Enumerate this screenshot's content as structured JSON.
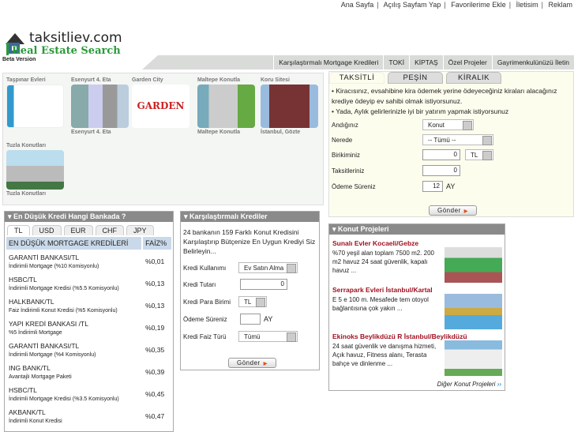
{
  "top_links": [
    "Ana Sayfa",
    "Açılış Sayfam Yap",
    "Favorilerime Ekle",
    "İletisim",
    "Reklam"
  ],
  "logo": {
    "name": "taksitliev.com",
    "tagline": "Real Estate Search"
  },
  "beta": "Beta Version",
  "nav": [
    "Karşılaştırmalı Mortgage Kredileri",
    "TOKİ",
    "KİPTAŞ",
    "Özel Projeler",
    "Gayrimenkulünüzü İletin"
  ],
  "projects": [
    {
      "top": "Taşpınar Evleri",
      "bottom": ""
    },
    {
      "top": "Esenyurt 4. Eta",
      "bottom": "Esenyurt 4. Eta"
    },
    {
      "top": "Garden City",
      "bottom": ""
    },
    {
      "top": "Maltepe Konutla",
      "bottom": "Maltepe Konutla"
    },
    {
      "top": "Koru Sitesi",
      "bottom": "İstanbul, Gözte"
    },
    {
      "top": "Tuzla Konutları",
      "bottom": "Tuzla Konutları"
    }
  ],
  "rates": {
    "title": "En Düşük Kredi Hangi Bankada ?",
    "tabs": [
      "TL",
      "USD",
      "EUR",
      "CHF",
      "JPY"
    ],
    "col1": "EN DÜŞÜK MORTGAGE KREDİLERİ",
    "col2": "FAİZ%",
    "rows": [
      {
        "bank": "GARANTİ BANKASI/TL",
        "product": "İndirimli Mortgage (%10 Komisyonlu)",
        "rate": "%0,01"
      },
      {
        "bank": "HSBC/TL",
        "product": "İndirimli Mortgage Kredisi (%5.5 Komisyonlu)",
        "rate": "%0,13"
      },
      {
        "bank": "HALKBANK/TL",
        "product": "Faiz İndirimli Konut Kredisi (%5 Komisyonlu)",
        "rate": "%0,13"
      },
      {
        "bank": "YAPI KREDİ BANKASI /TL",
        "product": "%5 İndirimli Mortgage",
        "rate": "%0,19"
      },
      {
        "bank": "GARANTİ BANKASI/TL",
        "product": "İndirimli Mortgage (%4 Komisyonlu)",
        "rate": "%0,35"
      },
      {
        "bank": "ING BANK/TL",
        "product": "Avantajlı Mortgage Paketi",
        "rate": "%0,39"
      },
      {
        "bank": "HSBC/TL",
        "product": "İndirimli Mortgage Kredisi (%3.5 Komisyonlu)",
        "rate": "%0,45"
      },
      {
        "bank": "AKBANK/TL",
        "product": "İndirimli Konut Kredisi",
        "rate": "%0,47"
      }
    ]
  },
  "compare": {
    "title": "Karşılaştırmalı Krediler",
    "intro": "24 bankanın 159 Farklı Konut Kredisini Karşılaştırıp Bütçenize En Uygun Krediyi Siz Belirleyin...",
    "usage_label": "Kredi Kullanımı",
    "usage": "Ev Satın Alma",
    "amount_label": "Kredi Tutarı",
    "amount": "0",
    "currency_label": "Kredi Para Birimi",
    "currency": "TL",
    "term_label": "Ödeme Süreniz",
    "term": "",
    "term_unit": "AY",
    "rate_label": "Kredi Faiz Türü",
    "rate_type": "Tümü",
    "submit": "Gönder"
  },
  "search": {
    "tabs": [
      "TAKSİTLİ",
      "PEŞİN",
      "KİRALIK"
    ],
    "bullets": [
      "Kiracısınız, evsahibine kira ödemek yerine ödeyeceğiniz kiraları alacağınız krediye ödeyip ev sahibi olmak istiyorsunuz.",
      "Yada, Aylık gelirlerinizle iyi bir yatırım yapmak istiyorsunuz"
    ],
    "type_label": "Andığınız",
    "type": "Konut",
    "where_label": "Nerede",
    "where": "-- Tümü --",
    "savings_label": "Birikiminiz",
    "savings": "0",
    "savings_currency": "TL",
    "inst_label": "Taksitleriniz",
    "inst": "0",
    "term_label": "Ödeme Süreniz",
    "term": "12",
    "term_unit": "AY",
    "submit": "Gönder"
  },
  "konut": {
    "title": "Konut Projeleri",
    "items": [
      {
        "title": "Sunalı Evler  Kocaeli/Gebze",
        "desc": "%70 yeşil alan toplam 7500 m2. 200 m2 havuz 24 saat güvenlik, kapalı havuz  ..."
      },
      {
        "title": "Serrapark Evleri  İstanbul/Kartal",
        "desc": "E 5 e 100 m. Mesafede tem otoyol bağlantısına çok yakın ..."
      },
      {
        "title": "Ekinoks Beylikdüzü R İstanbul/Beylikdüzü",
        "desc": "24 saat güvenlik ve danışma hizmeti, Açık havuz, Fitness alanı, Terasta bahçe ve dinlenme ..."
      }
    ],
    "more": "Diğer Konut Projeleri"
  }
}
